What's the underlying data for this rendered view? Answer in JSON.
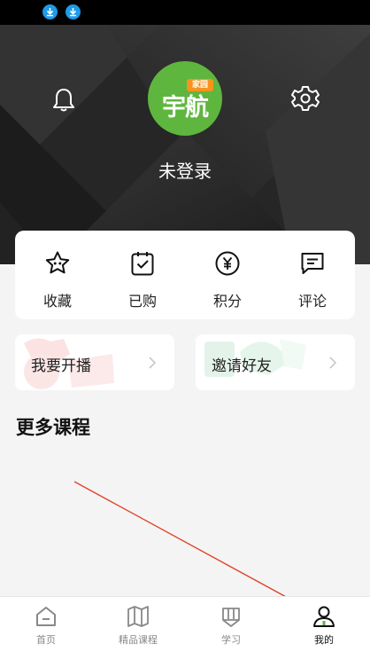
{
  "header": {
    "username": "未登录",
    "logo_badge": "家园",
    "logo_text": "宇航"
  },
  "quick_actions": [
    {
      "label": "收藏",
      "icon": "star-icon"
    },
    {
      "label": "已购",
      "icon": "clipboard-check-icon"
    },
    {
      "label": "积分",
      "icon": "yen-coin-icon"
    },
    {
      "label": "评论",
      "icon": "comment-icon"
    }
  ],
  "tiles": [
    {
      "label": "我要开播"
    },
    {
      "label": "邀请好友"
    }
  ],
  "section": {
    "title": "更多课程"
  },
  "tabbar": [
    {
      "label": "首页",
      "icon": "home-icon",
      "active": false
    },
    {
      "label": "精品课程",
      "icon": "book-icon",
      "active": false
    },
    {
      "label": "学习",
      "icon": "pencil-icon",
      "active": false
    },
    {
      "label": "我的",
      "icon": "person-icon",
      "active": true
    }
  ],
  "colors": {
    "status_bar": "#000000",
    "download_badge": "#1e9be9",
    "logo_green": "#5fb63e",
    "logo_badge": "#f7931e",
    "annotation": "#e0452a"
  }
}
